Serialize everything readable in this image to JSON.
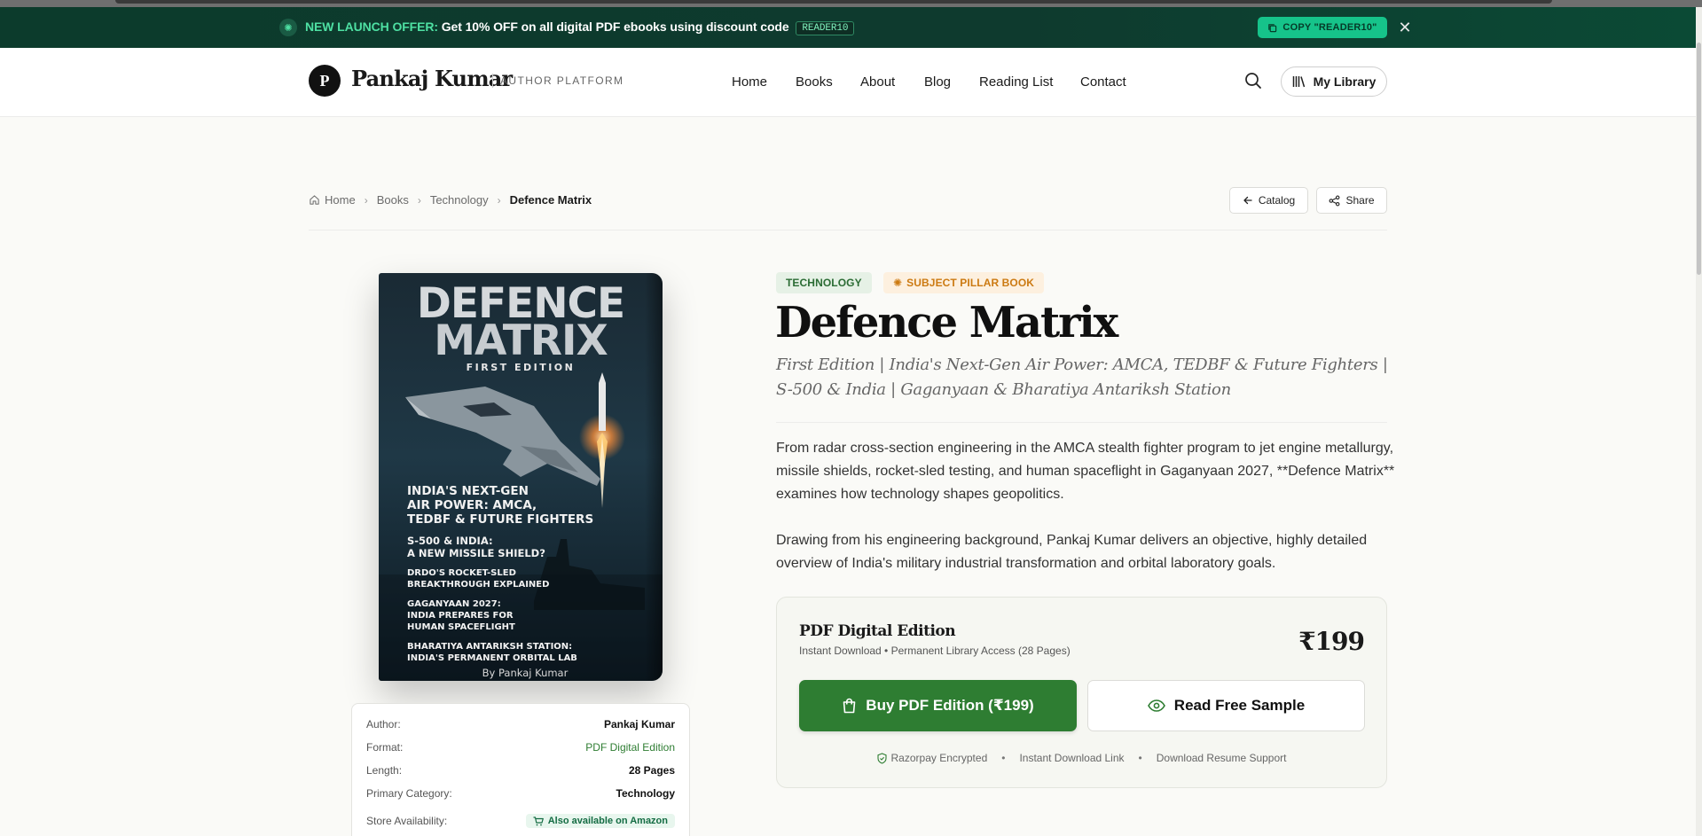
{
  "promo": {
    "highlight": "NEW LAUNCH OFFER:",
    "message": "Get 10% OFF on all digital PDF ebooks using discount code",
    "code": "READER10",
    "copy_label": "COPY \"READER10\""
  },
  "header": {
    "logo_letter": "P",
    "brand": "Pankaj Kumar",
    "tagline": "AUTHOR PLATFORM",
    "nav": [
      "Home",
      "Books",
      "About",
      "Blog",
      "Reading List",
      "Contact"
    ],
    "library_label": "My Library"
  },
  "breadcrumb": [
    "Home",
    "Books",
    "Technology",
    "Defence Matrix"
  ],
  "actions": {
    "catalog": "Catalog",
    "share": "Share"
  },
  "cover": {
    "title_line1": "DEFENCE",
    "title_line2": "MATRIX",
    "edition": "FIRST EDITION",
    "points": [
      [
        "INDIA'S NEXT-GEN",
        "AIR POWER: AMCA,",
        "TEDBF & FUTURE FIGHTERS"
      ],
      [
        "S-500 & INDIA:",
        "A NEW MISSILE SHIELD?"
      ],
      [
        "DRDO'S ROCKET-SLED",
        "BREAKTHROUGH EXPLAINED"
      ],
      [
        "GAGANYAAN 2027:",
        "INDIA PREPARES FOR",
        "HUMAN SPACEFLIGHT"
      ],
      [
        "BHARATIYA ANTARIKSH STATION:",
        "INDIA'S PERMANENT ORBITAL LAB"
      ]
    ],
    "byline": "By Pankaj Kumar"
  },
  "meta": {
    "author_label": "Author:",
    "author": "Pankaj Kumar",
    "format_label": "Format:",
    "format": "PDF Digital Edition",
    "length_label": "Length:",
    "length": "28 Pages",
    "category_label": "Primary Category:",
    "category": "Technology",
    "store_label": "Store Availability:",
    "store": "Also available on Amazon"
  },
  "tags": {
    "category": "TECHNOLOGY",
    "pillar": "SUBJECT PILLAR BOOK"
  },
  "book": {
    "title": "Defence Matrix",
    "subtitle": "First Edition | India's Next-Gen Air Power: AMCA, TEDBF & Future Fighters | S-500 & India | Gaganyaan & Bharatiya Antariksh Station",
    "desc1": "From radar cross-section engineering in the AMCA stealth fighter program to jet engine metallurgy, missile shields, rocket-sled testing, and human spaceflight in Gaganyaan 2027, **Defence Matrix** examines how technology shapes geopolitics.",
    "desc2": "Drawing from his engineering background, Pankaj Kumar delivers an objective, highly detailed overview of India's military industrial transformation and orbital laboratory goals."
  },
  "purchase": {
    "edition": "PDF Digital Edition",
    "edition_sub": "Instant Download • Permanent Library Access (28 Pages)",
    "price": "₹199",
    "buy_label": "Buy PDF Edition (₹199)",
    "sample_label": "Read Free Sample",
    "trust": [
      "Razorpay Encrypted",
      "Instant Download Link",
      "Download Resume Support"
    ]
  },
  "colors": {
    "brand_green": "#2e7d32",
    "promo_bg": "#0c3b2c",
    "promo_accent": "#16c38a",
    "pillar_orange": "#cc7a12"
  }
}
